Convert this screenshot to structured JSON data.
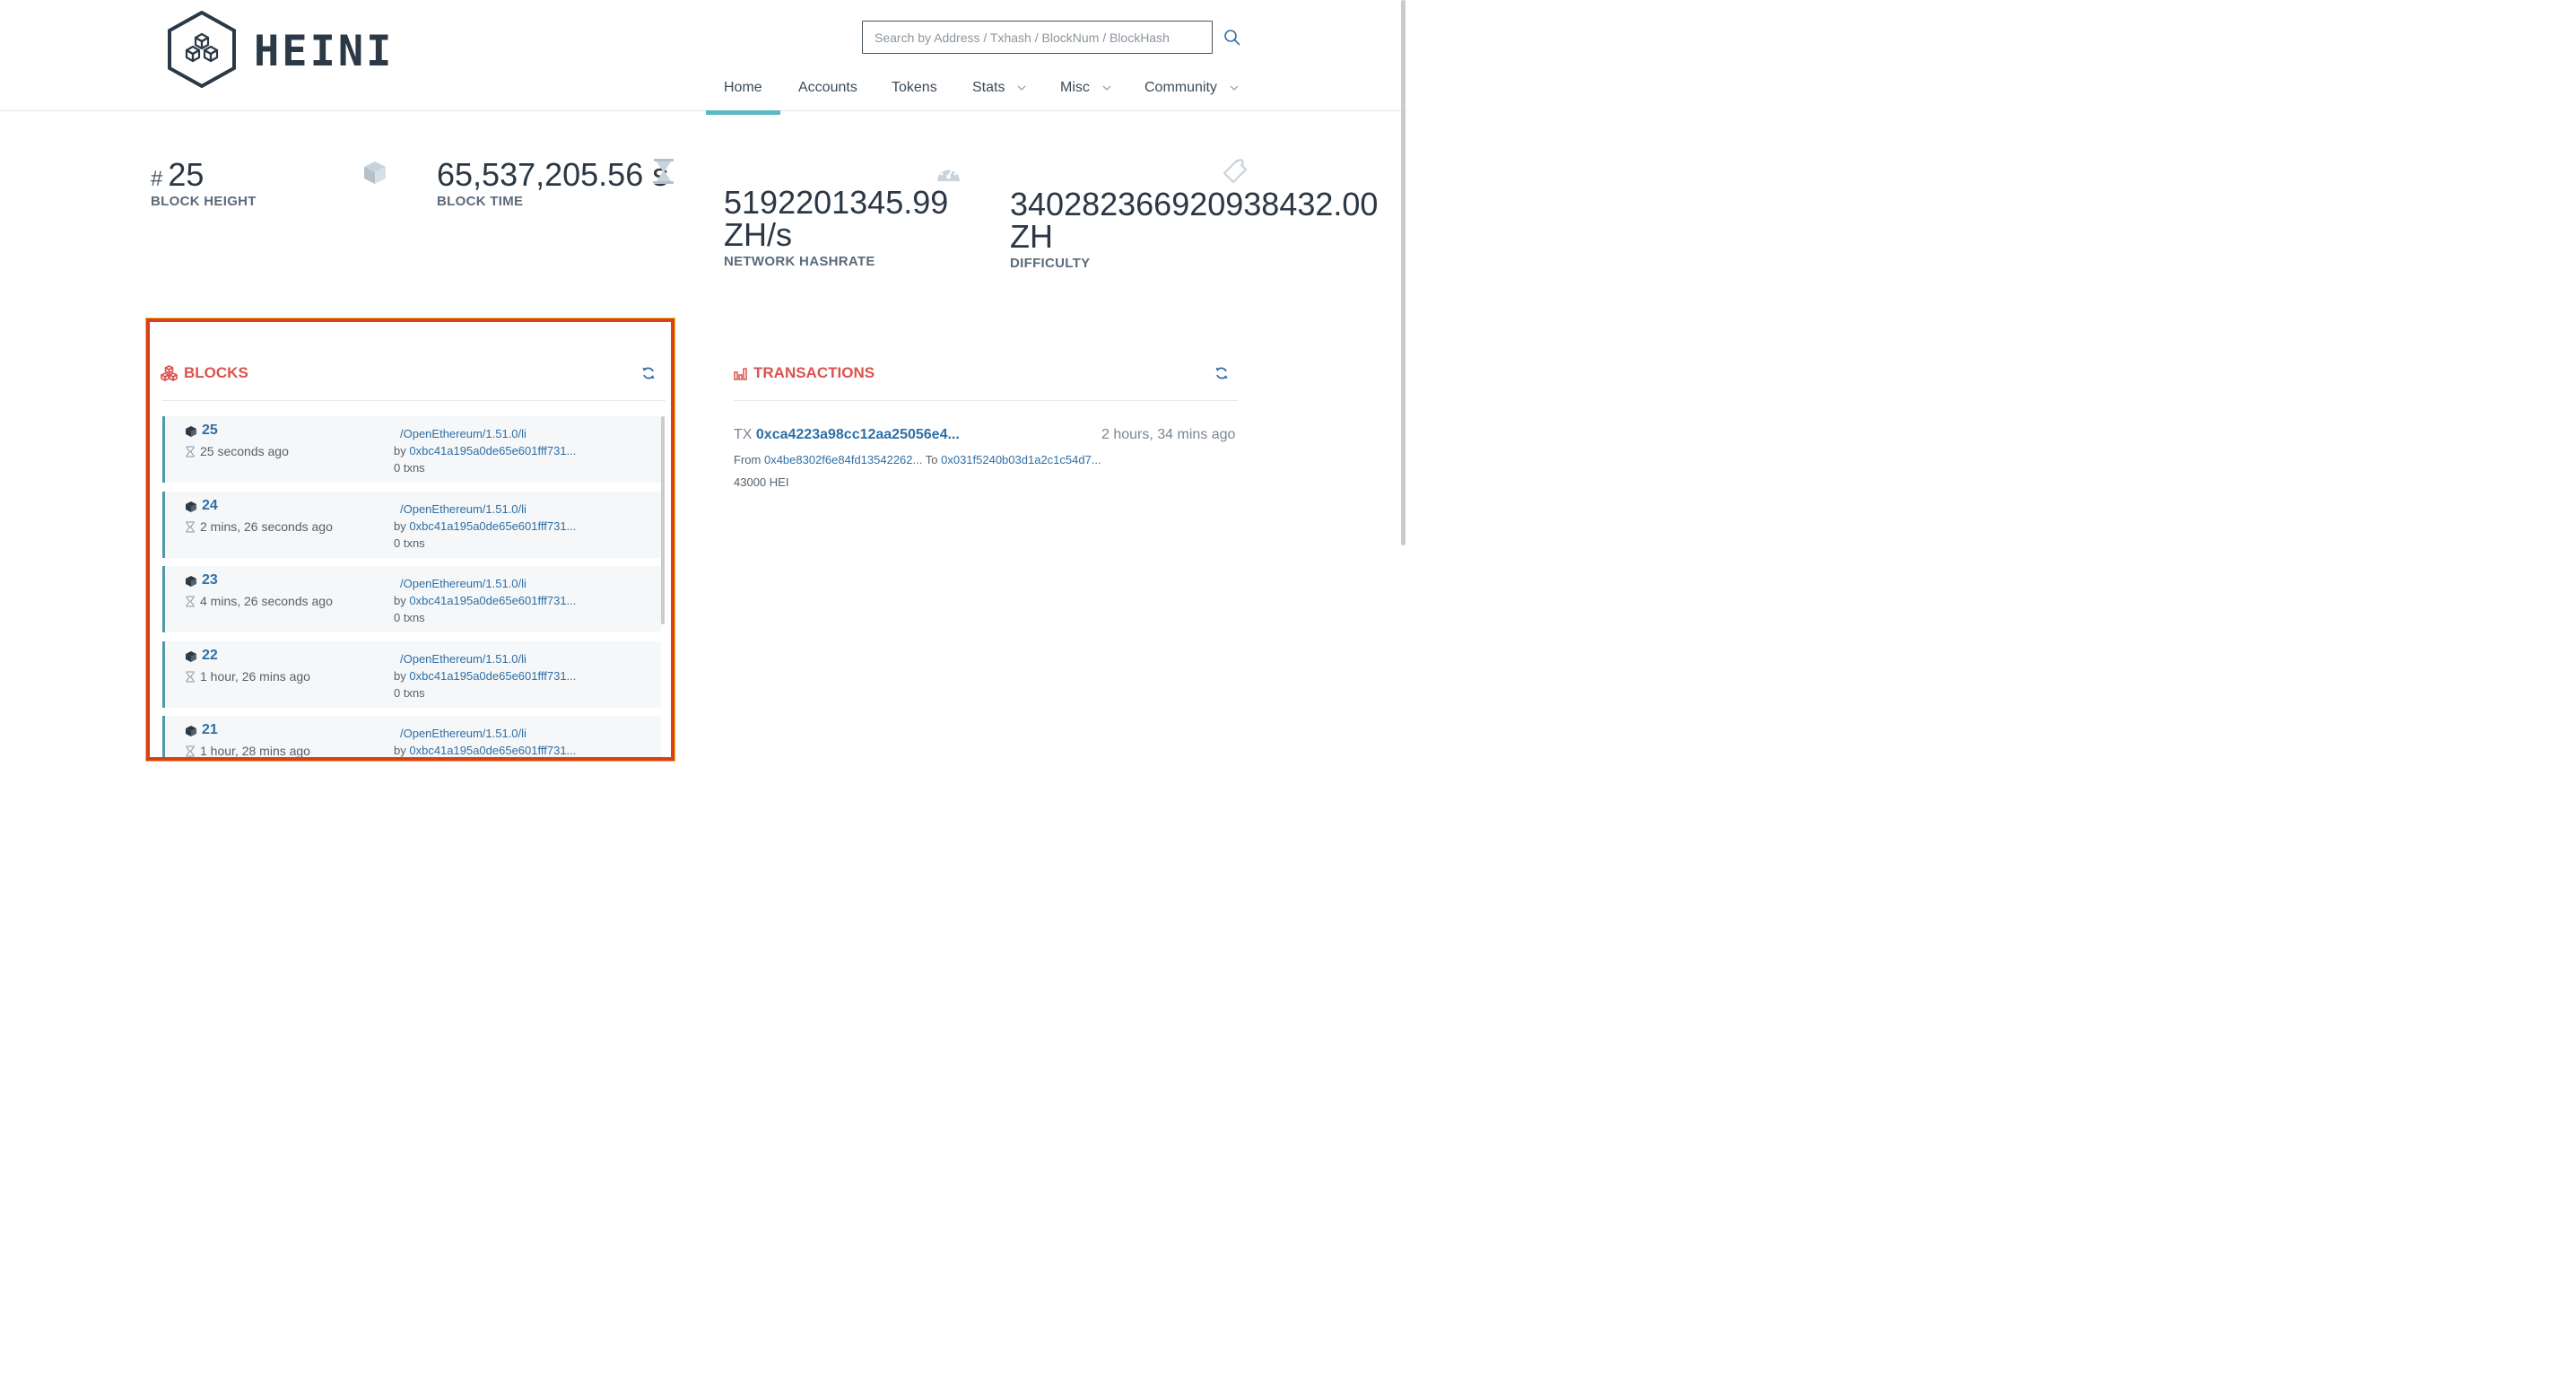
{
  "brand": {
    "name": "HEINI"
  },
  "search": {
    "placeholder": "Search by Address / Txhash / BlockNum / BlockHash"
  },
  "nav": [
    {
      "label": "Home",
      "active": true
    },
    {
      "label": "Accounts"
    },
    {
      "label": "Tokens"
    },
    {
      "label": "Stats",
      "dropdown": true
    },
    {
      "label": "Misc",
      "dropdown": true
    },
    {
      "label": "Community",
      "dropdown": true
    }
  ],
  "stats": {
    "height": {
      "prefix": "#",
      "value": "25",
      "label": "BLOCK HEIGHT",
      "icon": "cube-icon"
    },
    "time": {
      "value": "65,537,205.56 s",
      "label": "BLOCK TIME",
      "icon": "hourglass-icon"
    },
    "hashrate": {
      "value_line1": "5192201345.99",
      "value_line2": "ZH/s",
      "label": "NETWORK HASHRATE",
      "icon": "gauge-icon"
    },
    "difficulty": {
      "value_line1": "340282366920938432.00",
      "value_line2": "ZH",
      "label": "DIFFICULTY",
      "icon": "puzzle-icon"
    }
  },
  "blocks": {
    "title": "BLOCKS",
    "items": [
      {
        "number": "25",
        "age": "25 seconds ago",
        "client": "/OpenEthereum/1.51.0/li",
        "by": "by",
        "miner": "0xbc41a195a0de65e601fff731...",
        "txns": "0 txns"
      },
      {
        "number": "24",
        "age": "2 mins, 26 seconds ago",
        "client": "/OpenEthereum/1.51.0/li",
        "by": "by",
        "miner": "0xbc41a195a0de65e601fff731...",
        "txns": "0 txns"
      },
      {
        "number": "23",
        "age": "4 mins, 26 seconds ago",
        "client": "/OpenEthereum/1.51.0/li",
        "by": "by",
        "miner": "0xbc41a195a0de65e601fff731...",
        "txns": "0 txns"
      },
      {
        "number": "22",
        "age": "1 hour, 26 mins ago",
        "client": "/OpenEthereum/1.51.0/li",
        "by": "by",
        "miner": "0xbc41a195a0de65e601fff731...",
        "txns": "0 txns"
      },
      {
        "number": "21",
        "age": "1 hour, 28 mins ago",
        "client": "/OpenEthereum/1.51.0/li",
        "by": "by",
        "miner": "0xbc41a195a0de65e601fff731...",
        "txns": ""
      }
    ]
  },
  "transactions": {
    "title": "TRANSACTIONS",
    "items": [
      {
        "prefix": "TX",
        "hash": "0xca4223a98cc12aa25056e4...",
        "age": "2 hours, 34 mins ago",
        "from_label": "From",
        "from": "0x4be8302f6e84fd13542262...",
        "to_label": "To",
        "to": "0x031f5240b03d1a2c1c54d7...",
        "value": "43000 HEI"
      }
    ]
  },
  "colors": {
    "accent": "#5ab9c4",
    "title_red": "#d9534f",
    "link": "#2f6fa6",
    "highlight_border": "#d83f22"
  }
}
